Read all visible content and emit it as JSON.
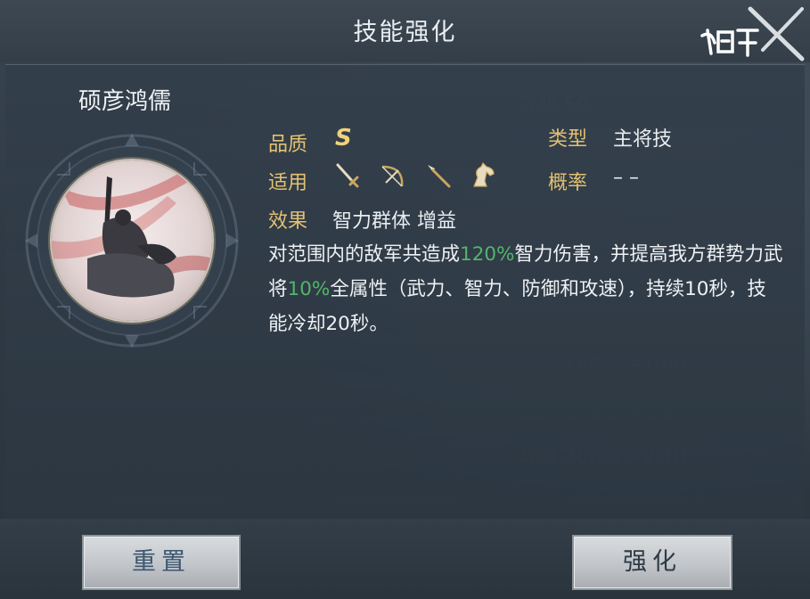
{
  "window": {
    "title": "技能强化",
    "logo_text": "鸿图之下"
  },
  "skill": {
    "name": "硕彦鸿儒",
    "quality_label": "品质",
    "quality_value": "S",
    "type_label": "类型",
    "type_value": "主将技",
    "usage_label": "适用",
    "usage_icons": [
      "sword-icon",
      "bow-icon",
      "spear-icon",
      "horse-icon"
    ],
    "rate_label": "概率",
    "rate_value": "– –",
    "effect_label": "效果",
    "effect_value": "智力群体 增益",
    "desc_part1": "对范围内的敌军共造成",
    "desc_hl1": "120%",
    "desc_part2": "智力伤害，并提高我方群势力武将",
    "desc_hl2": "10%",
    "desc_part3": "全属性（武力、智力、防御和攻速），持续10秒，技能冷却20秒。"
  },
  "buttons": {
    "reset": "重置",
    "enhance": "强化"
  },
  "colors": {
    "label": "#e3c170",
    "highlight": "#52b56a",
    "text": "#eef1f3"
  }
}
